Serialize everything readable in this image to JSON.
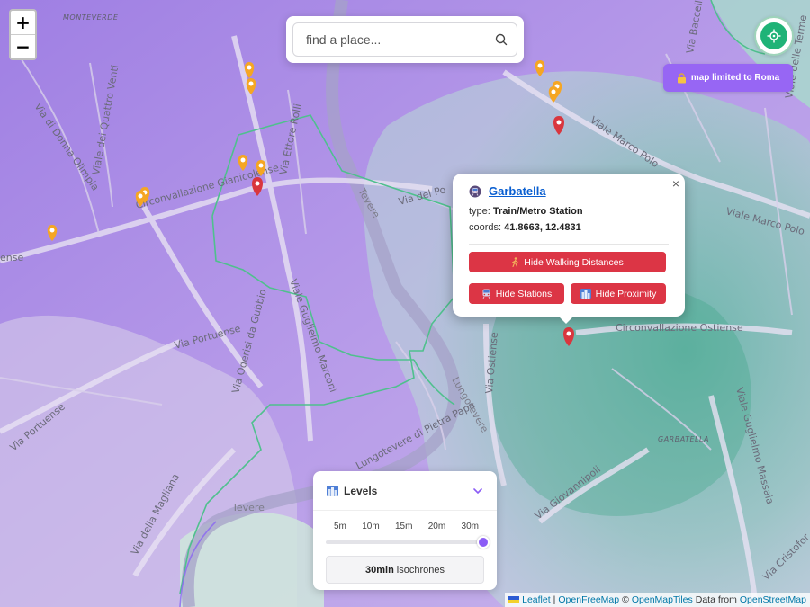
{
  "map": {
    "zoom_in_label": "+",
    "zoom_out_label": "−",
    "street_labels": {
      "monteverde": "MONTEVERDE",
      "via_di_donna_olimpia": "Via di Donna Olimpia",
      "viale_dei_quattro_venti": "Viale dei Quattro Venti",
      "circonvallazione_gianicolense": "Circonvallazione Gianicolense",
      "via_ettore_rolli": "Via Ettore Rolli",
      "via_del_porto": "Via del Po",
      "tevere_top": "Tevere",
      "viale_marco_polo_1": "Viale Marco Polo",
      "viale_marco_polo_2": "Viale Marco Polo",
      "via_portuense_1": "Via Portuense",
      "via_portuense_2": "Via Portuense",
      "via_oderisi_da_gubbio": "Via Oderisi da Gubbio",
      "viale_guglielmo_marconi": "Viale Guglielmo Marconi",
      "via_ostiense": "Via Ostiense",
      "circonvallazione_ostiense": "Circonvallazione Ostiense",
      "lungotevere_pietra_papa": "Lungotevere di Pietra Papa",
      "garbatella_area": "GARBATELLA",
      "viale_guglielmo_massaia": "Viale Guglielmo Massaia",
      "via_giovannipoli": "Via Giovannipoli",
      "via_della_magliana": "Via della Magliana",
      "tevere_bottom": "Tevere",
      "via_cristoforo": "Via Cristofor",
      "left_edge": "ense",
      "viale_del_tevere": "Lungotevere",
      "via_barelli": "Via Baccelli",
      "viale_terme": "Viale delle Terme"
    }
  },
  "search": {
    "placeholder": "find a place..."
  },
  "badge": {
    "icon": "lock-icon",
    "label": "map limited to Roma"
  },
  "popup": {
    "icon": "station-icon",
    "title": "Garbatella",
    "type_label": "type:",
    "type_value": "Train/Metro Station",
    "coords_label": "coords:",
    "coords_value": "41.8663, 12.4831",
    "close_label": "×",
    "buttons": {
      "walking": "Hide Walking Distances",
      "stations": "Hide Stations",
      "proximity": "Hide Proximity"
    }
  },
  "levels": {
    "title": "Levels",
    "ticks": [
      "5m",
      "10m",
      "15m",
      "20m",
      "30m"
    ],
    "selected_index": 4,
    "summary_value": "30min",
    "summary_text": "isochrones"
  },
  "attribution": {
    "leaflet": "Leaflet",
    "sep": "|",
    "openfreemap": "OpenFreeMap",
    "copyright": "©",
    "openmaptiles": "OpenMapTiles",
    "data_from": "Data from",
    "osm": "OpenStreetMap"
  },
  "colors": {
    "purple_zone": "#b39ae8",
    "teal_zone": "#9fd4c2",
    "accent_red": "#dc3545",
    "accent_purple": "#9766f4",
    "green_outline": "#4fc08d",
    "marker_orange": "#f5a623",
    "marker_red": "#d9363e"
  }
}
